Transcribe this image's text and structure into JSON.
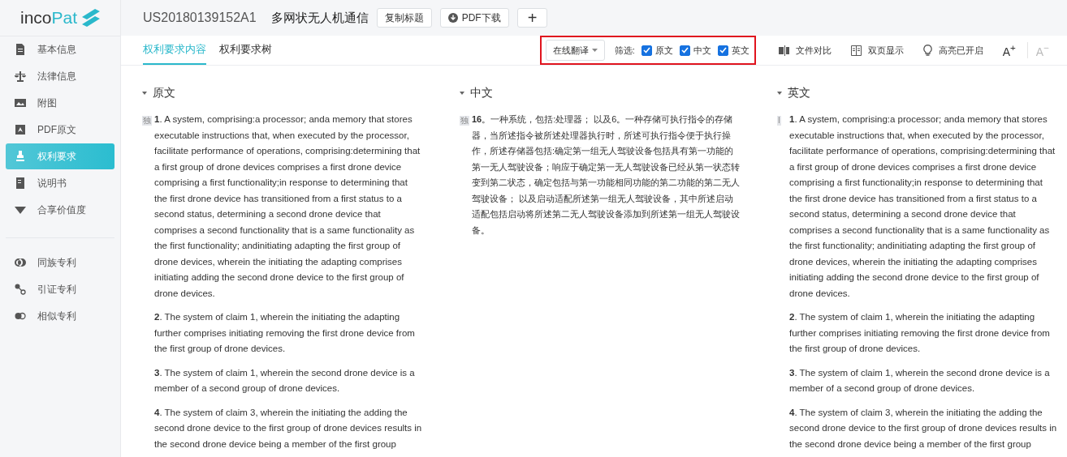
{
  "logo": {
    "text_dark": "inco",
    "text_accent": "Pat"
  },
  "header": {
    "patent_number": "US20180139152A1",
    "title": "多网状无人机通信",
    "buttons": [
      {
        "kind": "copy",
        "label": "复制标题"
      },
      {
        "kind": "pdf",
        "label": "PDF下载"
      },
      {
        "kind": "add",
        "label": "+"
      }
    ]
  },
  "sidebar": {
    "groups": [
      [
        {
          "kind": "doc",
          "label": "基本信息",
          "selected": false
        },
        {
          "kind": "scale",
          "label": "法律信息",
          "selected": false
        },
        {
          "kind": "image",
          "label": "附图",
          "selected": false
        },
        {
          "kind": "pdf",
          "label": "PDF原文",
          "selected": false
        },
        {
          "kind": "stamp",
          "label": "权利要求",
          "selected": true
        },
        {
          "kind": "book",
          "label": "说明书",
          "selected": false
        },
        {
          "kind": "diamond",
          "label": "合享价值度",
          "selected": false
        }
      ],
      [
        {
          "kind": "rings",
          "label": "同族专利",
          "selected": false
        },
        {
          "kind": "nodes",
          "label": "引证专利",
          "selected": false
        },
        {
          "kind": "toggle",
          "label": "相似专利",
          "selected": false
        }
      ]
    ]
  },
  "tabs": [
    {
      "label": "权利要求内容",
      "selected": true
    },
    {
      "label": "权利要求树",
      "selected": false
    }
  ],
  "toolbar": {
    "translate": "在线翻译",
    "filter_label": "筛选:",
    "filters": [
      {
        "label": "原文",
        "checked": true
      },
      {
        "label": "中文",
        "checked": true
      },
      {
        "label": "英文",
        "checked": true
      }
    ],
    "tools": [
      {
        "kind": "compare",
        "label": "文件对比",
        "disabled": false
      },
      {
        "kind": "pages",
        "label": "双页显示",
        "disabled": false
      },
      {
        "kind": "bulb",
        "label": "高亮已开启",
        "disabled": false
      },
      {
        "kind": "font",
        "label": "A$^{+}$",
        "disabled": false
      },
      {
        "kind": "font",
        "label": "A$^{−}$",
        "disabled": true
      }
    ]
  },
  "columns": [
    {
      "heading": "原文",
      "expanded": true,
      "kind": "latin",
      "claims": [
        {
          "badge": "独",
          "text": "**1**. A system, comprising:a processor; anda memory that stores executable instructions that, when executed by the processor, facilitate performance of operations, comprising:determining that a first group of drone devices comprises a first drone device comprising a first functionality;in response to determining that the first drone device has transitioned from a first status to a second status, determining a second drone device that comprises a second functionality that is a same functionality as the first functionality; andinitiating adapting the first group of drone devices, wherein the initiating the adapting comprises initiating adding the second drone device to the first group of drone devices."
        },
        {
          "text": "**2**. The system of claim 1, wherein the initiating the adapting further comprises initiating removing the first drone device from the first group of drone devices."
        },
        {
          "text": "**3**. The system of claim 1, wherein the second drone device is a member of a second group of drone devices."
        },
        {
          "text": "**4**. The system of claim 3, wherein the initiating the adding the second drone device to the first group of drone devices results in the second drone device being a member of the first group"
        }
      ]
    },
    {
      "heading": "中文",
      "expanded": true,
      "kind": "cjk",
      "claims": [
        {
          "badge": "独",
          "text": "**16**。一种系统，包括:处理器； 以及6。一种存储可执行指令的存储器，当所述指令被所述处理器执行时，所述可执行指令便于执行操作，所述存储器包括:确定第一组无人驾驶设备包括具有第一功能的第一无人驾驶设备；响应于确定第一无人驾驶设备已经从第一状态转变到第二状态，确定包括与第一功能相同功能的第二功能的第二无人驾驶设备； 以及启动适配所述第一组无人驾驶设备，其中所述启动适配包括启动将所述第二无人驾驶设备添加到所述第一组无人驾驶设备。"
        }
      ]
    },
    {
      "heading": "英文",
      "expanded": true,
      "kind": "latin",
      "claims": [
        {
          "badge": "I",
          "text": "**1**. A system, comprising:a processor; anda memory that stores executable instructions that, when executed by the processor, facilitate performance of operations, comprising:determining that a first group of drone devices comprises a first drone device comprising a first functionality;in response to determining that the first drone device has transitioned from a first status to a second status, determining a second drone device that comprises a second functionality that is a same functionality as the first functionality; andinitiating adapting the first group of drone devices, wherein the initiating the adapting comprises initiating adding the second drone device to the first group of drone devices."
        },
        {
          "text": "**2**. The system of claim 1, wherein the initiating the adapting further comprises initiating removing the first drone device from the first group of drone devices."
        },
        {
          "text": "**3**. The system of claim 1, wherein the second drone device is a member of a second group of drone devices."
        },
        {
          "text": "**4**. The system of claim 3, wherein the initiating the adding the second drone device to the first group of drone devices results in the second drone device being a member of the first group"
        }
      ]
    }
  ]
}
